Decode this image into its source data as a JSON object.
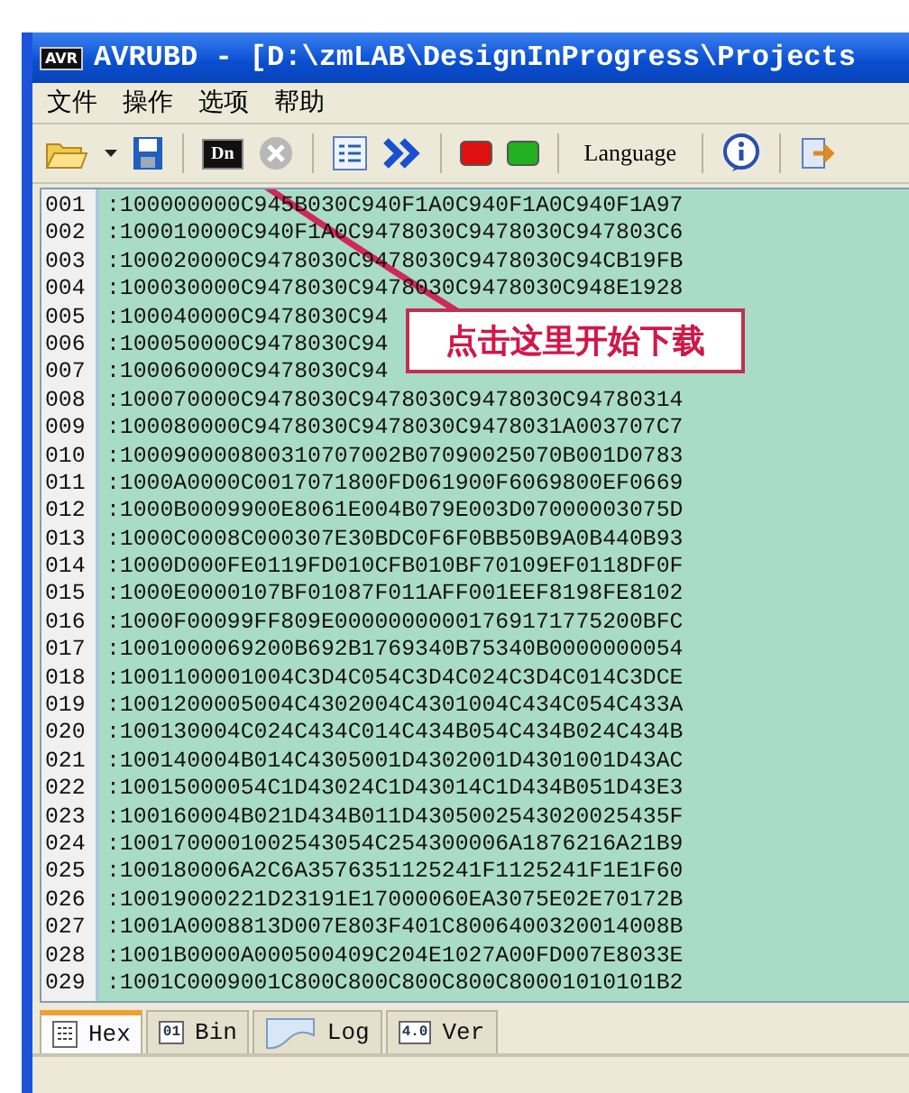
{
  "window": {
    "icon_text": "AVR",
    "title": "AVRUBD - [D:\\zmLAB\\DesignInProgress\\Projects"
  },
  "menu": [
    "文件",
    "操作",
    "选项",
    "帮助"
  ],
  "toolbar": [
    {
      "kind": "folder"
    },
    {
      "kind": "caret"
    },
    {
      "kind": "save"
    },
    {
      "kind": "sep"
    },
    {
      "kind": "chip",
      "label": "Dn"
    },
    {
      "kind": "cancel",
      "disabled": true
    },
    {
      "kind": "sep"
    },
    {
      "kind": "list"
    },
    {
      "kind": "forward"
    },
    {
      "kind": "sep"
    },
    {
      "kind": "led",
      "color": "#e01010"
    },
    {
      "kind": "led",
      "color": "#20b020"
    },
    {
      "kind": "sep"
    },
    {
      "kind": "text",
      "label": "Language"
    },
    {
      "kind": "sep"
    },
    {
      "kind": "info"
    },
    {
      "kind": "sep"
    },
    {
      "kind": "exit"
    }
  ],
  "editor": {
    "lines": [
      {
        "number": "001",
        "text": ":100000000C945B030C940F1A0C940F1A0C940F1A97"
      },
      {
        "number": "002",
        "text": ":100010000C940F1A0C9478030C9478030C947803C6"
      },
      {
        "number": "003",
        "text": ":100020000C9478030C9478030C9478030C94CB19FB"
      },
      {
        "number": "004",
        "text": ":100030000C9478030C9478030C9478030C948E1928"
      },
      {
        "number": "005",
        "text": ":100040000C9478030C94"
      },
      {
        "number": "006",
        "text": ":100050000C9478030C94"
      },
      {
        "number": "007",
        "text": ":100060000C9478030C94"
      },
      {
        "number": "008",
        "text": ":100070000C9478030C9478030C9478030C94780314"
      },
      {
        "number": "009",
        "text": ":100080000C9478030C9478030C9478031A003707C7"
      },
      {
        "number": "010",
        "text": ":100090000800310707002B07090025070B001D0783"
      },
      {
        "number": "011",
        "text": ":1000A0000C0017071800FD061900F6069800EF0669"
      },
      {
        "number": "012",
        "text": ":1000B0009900E8061E004B079E003D07000003075D"
      },
      {
        "number": "013",
        "text": ":1000C0008C000307E30BDC0F6F0BB50B9A0B440B93"
      },
      {
        "number": "014",
        "text": ":1000D000FE0119FD010CFB010BF70109EF0118DF0F"
      },
      {
        "number": "015",
        "text": ":1000E0000107BF01087F011AFF001EEF8198FE8102"
      },
      {
        "number": "016",
        "text": ":1000F00099FF809E00000000001769171775200BFC"
      },
      {
        "number": "017",
        "text": ":1001000069200B692B1769340B75340B0000000054"
      },
      {
        "number": "018",
        "text": ":1001100001004C3D4C054C3D4C024C3D4C014C3DCE"
      },
      {
        "number": "019",
        "text": ":1001200005004C4302004C4301004C434C054C433A"
      },
      {
        "number": "020",
        "text": ":100130004C024C434C014C434B054C434B024C434B"
      },
      {
        "number": "021",
        "text": ":100140004B014C4305001D4302001D4301001D43AC"
      },
      {
        "number": "022",
        "text": ":10015000054C1D43024C1D43014C1D434B051D43E3"
      },
      {
        "number": "023",
        "text": ":100160004B021D434B011D4305002543020025435F"
      },
      {
        "number": "024",
        "text": ":1001700001002543054C254300006A1876216A21B9"
      },
      {
        "number": "025",
        "text": ":100180006A2C6A3576351125241F1125241F1E1F60"
      },
      {
        "number": "026",
        "text": ":10019000221D23191E17000060EA3075E02E70172B"
      },
      {
        "number": "027",
        "text": ":1001A0008813D007E803F401C8006400320014008B"
      },
      {
        "number": "028",
        "text": ":1001B0000A000500409C204E1027A00FD007E8033E"
      },
      {
        "number": "029",
        "text": ":1001C0009001C800C800C800C800C80001010101B2"
      }
    ]
  },
  "callout": {
    "text": "点击这里开始下载"
  },
  "tabs": [
    {
      "label": "Hex",
      "kind": "grid",
      "selected": true
    },
    {
      "label": "Bin",
      "kind": "doc",
      "icon_text": "01",
      "selected": false
    },
    {
      "label": "Log",
      "kind": "page",
      "selected": false
    },
    {
      "label": "Ver",
      "kind": "doc",
      "icon_text": "4.0",
      "selected": false
    }
  ]
}
